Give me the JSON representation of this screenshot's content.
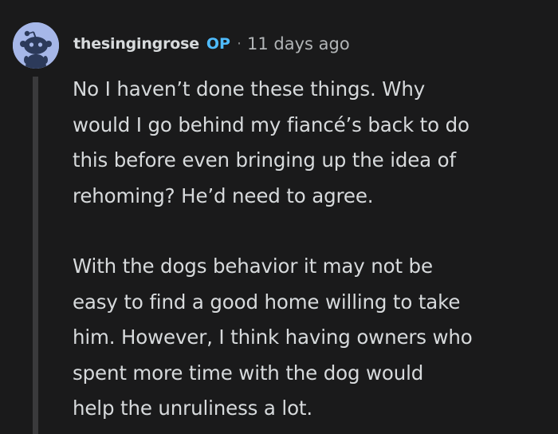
{
  "comment": {
    "author": "thesingingrose",
    "badge": "OP",
    "separator": "·",
    "timestamp": "11 days ago",
    "avatar": {
      "icon": "reddit-snoo-avatar-icon",
      "background": "#a6b7e8"
    },
    "paragraphs": [
      {
        "lines": [
          "No I haven’t done these things. Why",
          "would I go behind my fiancé’s back to do",
          "this before even bringing up the idea of",
          "rehoming? He’d need to agree."
        ]
      },
      {
        "lines": [
          "With the dogs behavior it may not be",
          "easy to find a good home willing to take",
          "him. However, I think having owners who",
          "spent more time with the dog would",
          "help the unruliness a lot."
        ]
      }
    ]
  },
  "colors": {
    "background": "#1a1a1b",
    "text": "#d7dadc",
    "op_badge": "#4fbcff",
    "meta": "#818384",
    "thread_line": "#3a3a3c"
  }
}
